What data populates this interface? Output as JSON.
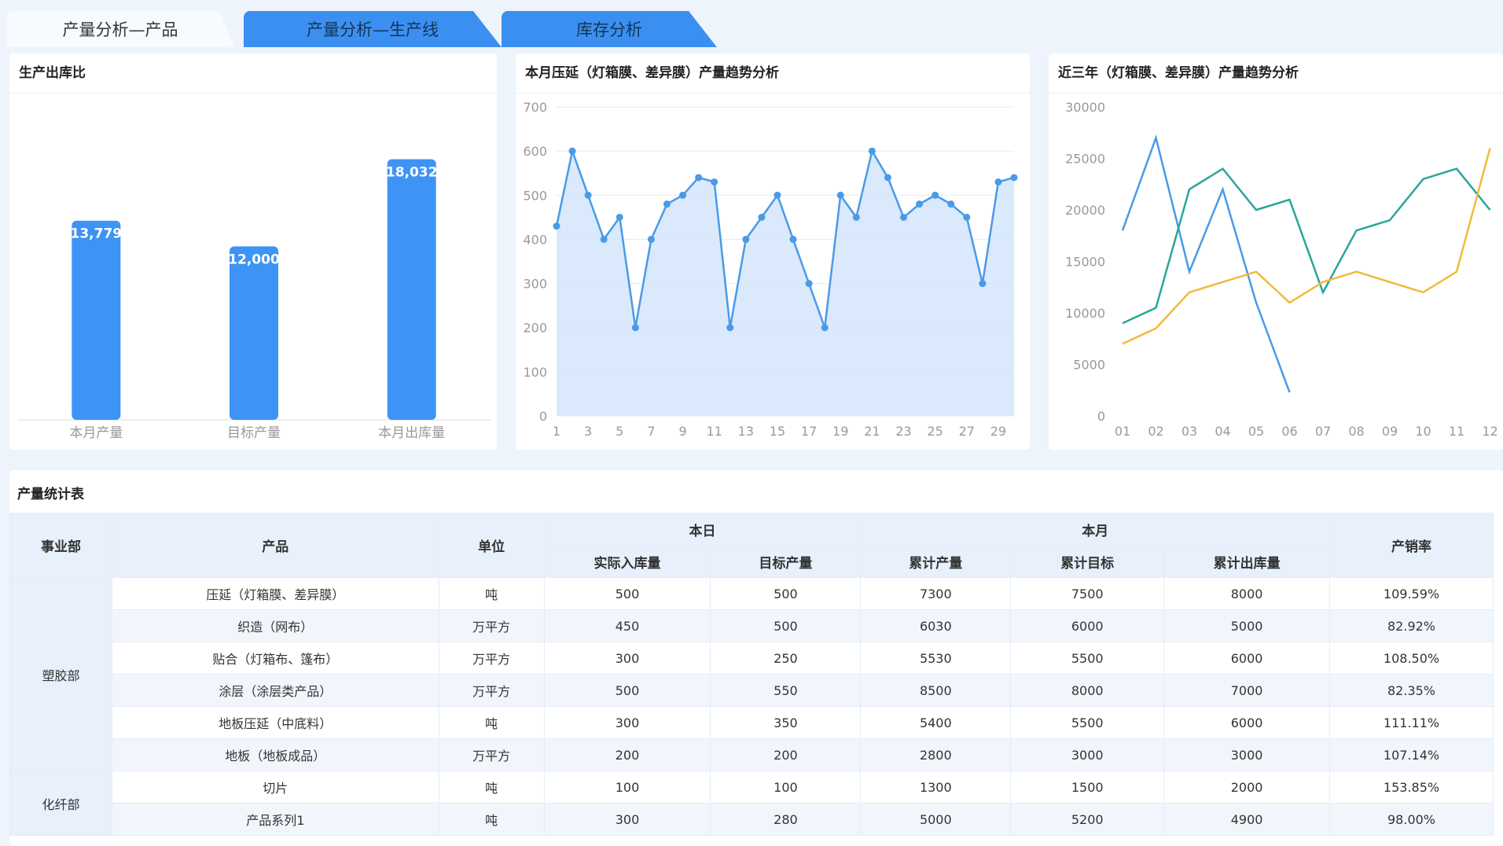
{
  "tabs": [
    {
      "label": "产量分析—产品"
    },
    {
      "label": "产量分析—生产线"
    },
    {
      "label": "库存分析"
    }
  ],
  "panels": {
    "bar_title": "生产出库比",
    "line_title": "本月压延（灯箱膜、差异膜）产量趋势分析",
    "multi_title": "近三年（灯箱膜、差异膜）产量趋势分析"
  },
  "colors": {
    "accent": "#3b8ff0",
    "bar": "#3d94f5",
    "area_fill": "#d6e7fb",
    "series_blue": "#4a9ae8",
    "series_teal": "#2aa59a",
    "series_yellow": "#f2b93b"
  },
  "chart_data": [
    {
      "type": "bar",
      "title": "生产出库比",
      "categories": [
        "本月产量",
        "目标产量",
        "本月出库量"
      ],
      "values": [
        13779,
        12000,
        18032
      ],
      "value_labels": [
        "13,779",
        "12,000",
        "18,032"
      ],
      "ylim": [
        0,
        21000
      ],
      "grid": false
    },
    {
      "type": "area",
      "title": "本月压延（灯箱膜、差异膜）产量趋势分析",
      "x": [
        1,
        2,
        3,
        4,
        5,
        6,
        7,
        8,
        9,
        10,
        11,
        12,
        13,
        14,
        15,
        16,
        17,
        18,
        19,
        20,
        21,
        22,
        23,
        24,
        25,
        26,
        27,
        28,
        29,
        30
      ],
      "x_tick_labels": [
        "1",
        "3",
        "5",
        "7",
        "9",
        "11",
        "13",
        "15",
        "17",
        "19",
        "21",
        "23",
        "25",
        "27",
        "29"
      ],
      "values": [
        430,
        600,
        500,
        400,
        450,
        200,
        400,
        480,
        500,
        540,
        530,
        200,
        400,
        450,
        500,
        400,
        300,
        200,
        500,
        450,
        600,
        540,
        450,
        480,
        500,
        480,
        450,
        300,
        530,
        540
      ],
      "ylim": [
        0,
        700
      ],
      "y_ticks": [
        "0",
        "100",
        "200",
        "300",
        "400",
        "500",
        "600",
        "700"
      ],
      "grid": true
    },
    {
      "type": "line",
      "title": "近三年（灯箱膜、差异膜）产量趋势分析",
      "categories": [
        "01",
        "02",
        "03",
        "04",
        "05",
        "06",
        "07",
        "08",
        "09",
        "10",
        "11",
        "12"
      ],
      "series": [
        {
          "values": [
            18000,
            27000,
            14000,
            22000,
            11000,
            2300,
            null,
            null,
            null,
            null,
            null,
            null
          ]
        },
        {
          "values": [
            9000,
            10500,
            22000,
            24000,
            20000,
            21000,
            12000,
            18000,
            19000,
            23000,
            24000,
            20000
          ]
        },
        {
          "values": [
            7000,
            8500,
            12000,
            13000,
            14000,
            11000,
            13000,
            14000,
            13000,
            12000,
            14000,
            26000
          ]
        }
      ],
      "ylim": [
        0,
        30000
      ],
      "y_ticks": [
        "0",
        "5000",
        "10000",
        "15000",
        "20000",
        "25000",
        "30000"
      ],
      "grid": false
    }
  ],
  "table": {
    "title": "产量统计表",
    "headers": {
      "dept": "事业部",
      "product": "产品",
      "unit": "单位",
      "today": "本日",
      "month": "本月",
      "rate": "产销率",
      "actual_in": "实际入库量",
      "target": "目标产量",
      "cum_prod": "累计产量",
      "cum_target": "累计目标",
      "cum_out": "累计出库量"
    },
    "groups": [
      {
        "dept": "塑胶部",
        "rows": [
          [
            "压延（灯箱膜、差异膜）",
            "吨",
            "500",
            "500",
            "7300",
            "7500",
            "8000",
            "109.59%"
          ],
          [
            "织造（网布）",
            "万平方",
            "450",
            "500",
            "6030",
            "6000",
            "5000",
            "82.92%"
          ],
          [
            "贴合（灯箱布、篷布）",
            "万平方",
            "300",
            "250",
            "5530",
            "5500",
            "6000",
            "108.50%"
          ],
          [
            "涂层（涂层类产品）",
            "万平方",
            "500",
            "550",
            "8500",
            "8000",
            "7000",
            "82.35%"
          ],
          [
            "地板压延（中底料）",
            "吨",
            "300",
            "350",
            "5400",
            "5500",
            "6000",
            "111.11%"
          ],
          [
            "地板（地板成品）",
            "万平方",
            "200",
            "200",
            "2800",
            "3000",
            "3000",
            "107.14%"
          ]
        ]
      },
      {
        "dept": "化纤部",
        "rows": [
          [
            "切片",
            "吨",
            "100",
            "100",
            "1300",
            "1500",
            "2000",
            "153.85%"
          ],
          [
            "产品系列1",
            "吨",
            "300",
            "280",
            "5000",
            "5200",
            "4900",
            "98.00%"
          ]
        ]
      }
    ]
  }
}
